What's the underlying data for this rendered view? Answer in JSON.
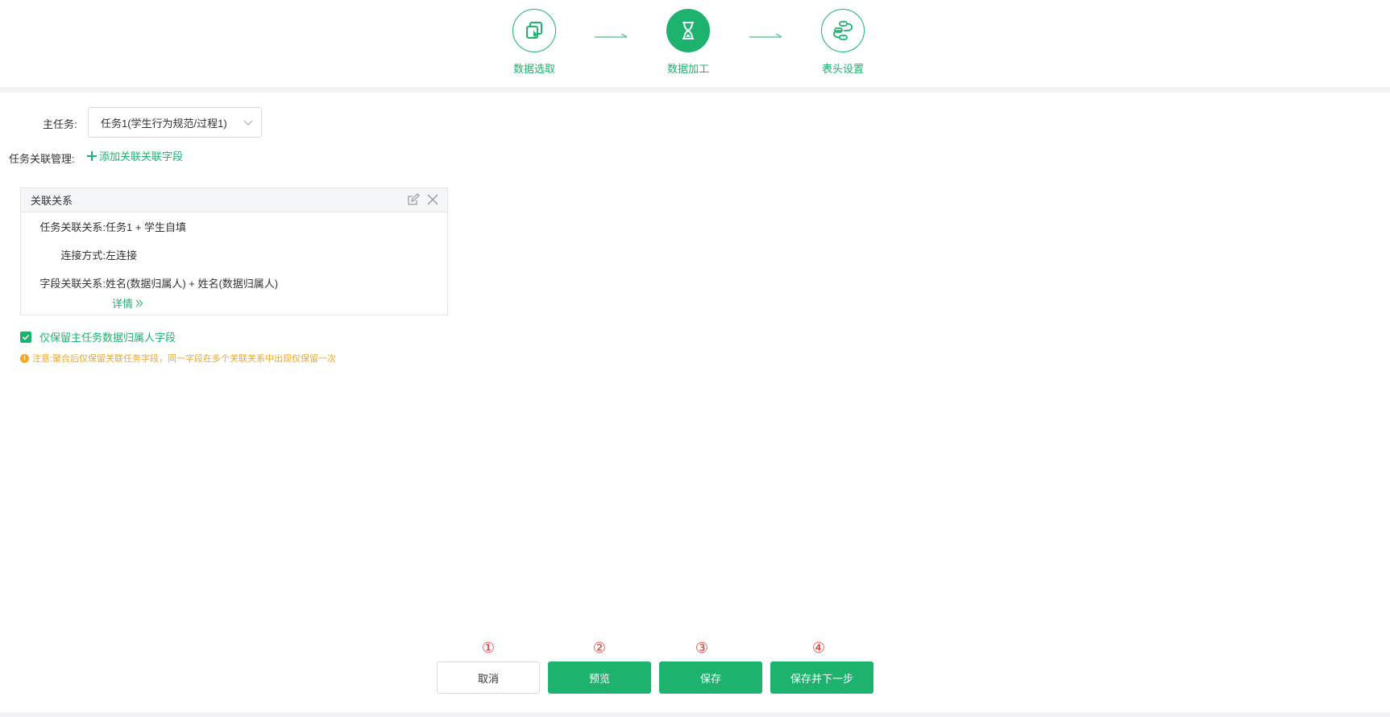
{
  "steps": [
    {
      "label": "数据选取",
      "icon": "copy-cursor-icon",
      "active": false
    },
    {
      "label": "数据加工",
      "icon": "hourglass-icon",
      "active": true
    },
    {
      "label": "表头设置",
      "icon": "link-chain-icon",
      "active": false
    }
  ],
  "form": {
    "main_task_label": "主任务:",
    "main_task_value": "任务1(学生行为规范/过程1)",
    "relation_mgmt_label": "任务关联管理:",
    "add_relation_link": "添加关联关联字段"
  },
  "card": {
    "title": "关联关系",
    "task_relation_label": "任务关联关系:",
    "task_relation_value": "任务1 + 学生自填",
    "join_type_label": "连接方式:",
    "join_type_value": "左连接",
    "field_relation_label": "字段关联关系:",
    "field_relation_value": "姓名(数据归属人) + 姓名(数据归属人)",
    "detail_link": "详情"
  },
  "checkbox": {
    "label": "仅保留主任务数据归属人字段",
    "checked": true
  },
  "note": {
    "text": "注意:聚合后仅保留关联任务字段，同一字段在多个关联关系中出现仅保留一次"
  },
  "buttons": {
    "cancel": "取消",
    "preview": "预览",
    "save": "保存",
    "save_next": "保存并下一步"
  },
  "markers": [
    "①",
    "②",
    "③",
    "④"
  ],
  "colors": {
    "accent": "#1db26e",
    "warning": "#f5a623",
    "marker": "#e53935"
  }
}
